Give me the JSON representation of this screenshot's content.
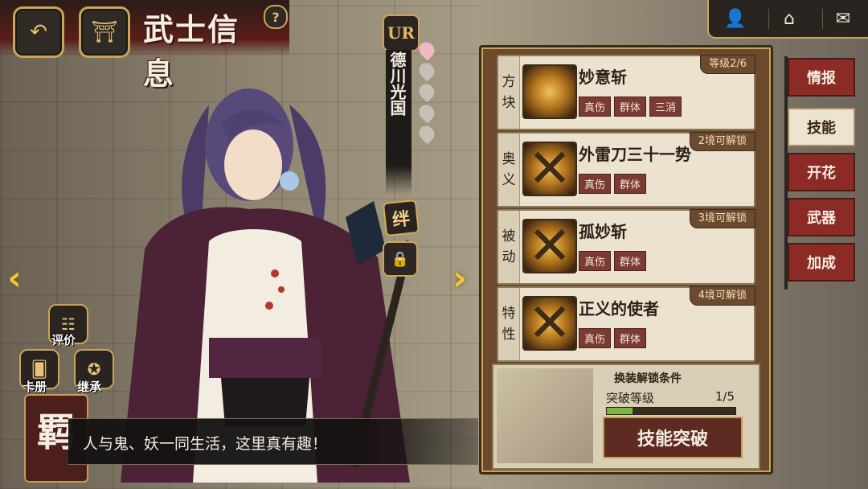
{
  "header": {
    "title": "武士信息",
    "help": "?",
    "back_icon": "back-arrow-icon",
    "home_icon": "home-gate-icon"
  },
  "topnav": {
    "items": [
      {
        "name": "character",
        "glyph": "👤"
      },
      {
        "name": "home",
        "glyph": "⌂"
      },
      {
        "name": "mail",
        "glyph": "✉"
      }
    ]
  },
  "character": {
    "rarity": "UR",
    "name": "德川光国",
    "stars_total": 5,
    "stars_active": 1,
    "bond": "绊",
    "dialog": "人与鬼、妖一同生活，这里真有趣！"
  },
  "left_buttons": {
    "review": "评价",
    "album": "卡册",
    "inherit": "继承",
    "stamp": "羁"
  },
  "skills": [
    {
      "type": "方块",
      "name": "妙意斩",
      "tags": [
        "真伤",
        "群体",
        "三消"
      ],
      "corner": "等级2/6",
      "locked": false
    },
    {
      "type": "奥义",
      "name": "外雷刀三十一势",
      "tags": [
        "真伤",
        "群体"
      ],
      "corner": "2境可解锁",
      "locked": true
    },
    {
      "type": "被动",
      "name": "孤妙斩",
      "tags": [
        "真伤",
        "群体"
      ],
      "corner": "3境可解锁",
      "locked": true
    },
    {
      "type": "特性",
      "name": "正义的使者",
      "tags": [
        "真伤",
        "群体"
      ],
      "corner": "4境可解锁",
      "locked": true
    }
  ],
  "breakthrough": {
    "title": "换装解锁条件",
    "label": "突破等级",
    "current": 1,
    "total": 5,
    "ratio_text": "1/5",
    "button": "技能突破"
  },
  "tabs": [
    "情报",
    "技能",
    "开花",
    "武器",
    "加成"
  ],
  "active_tab": 1
}
